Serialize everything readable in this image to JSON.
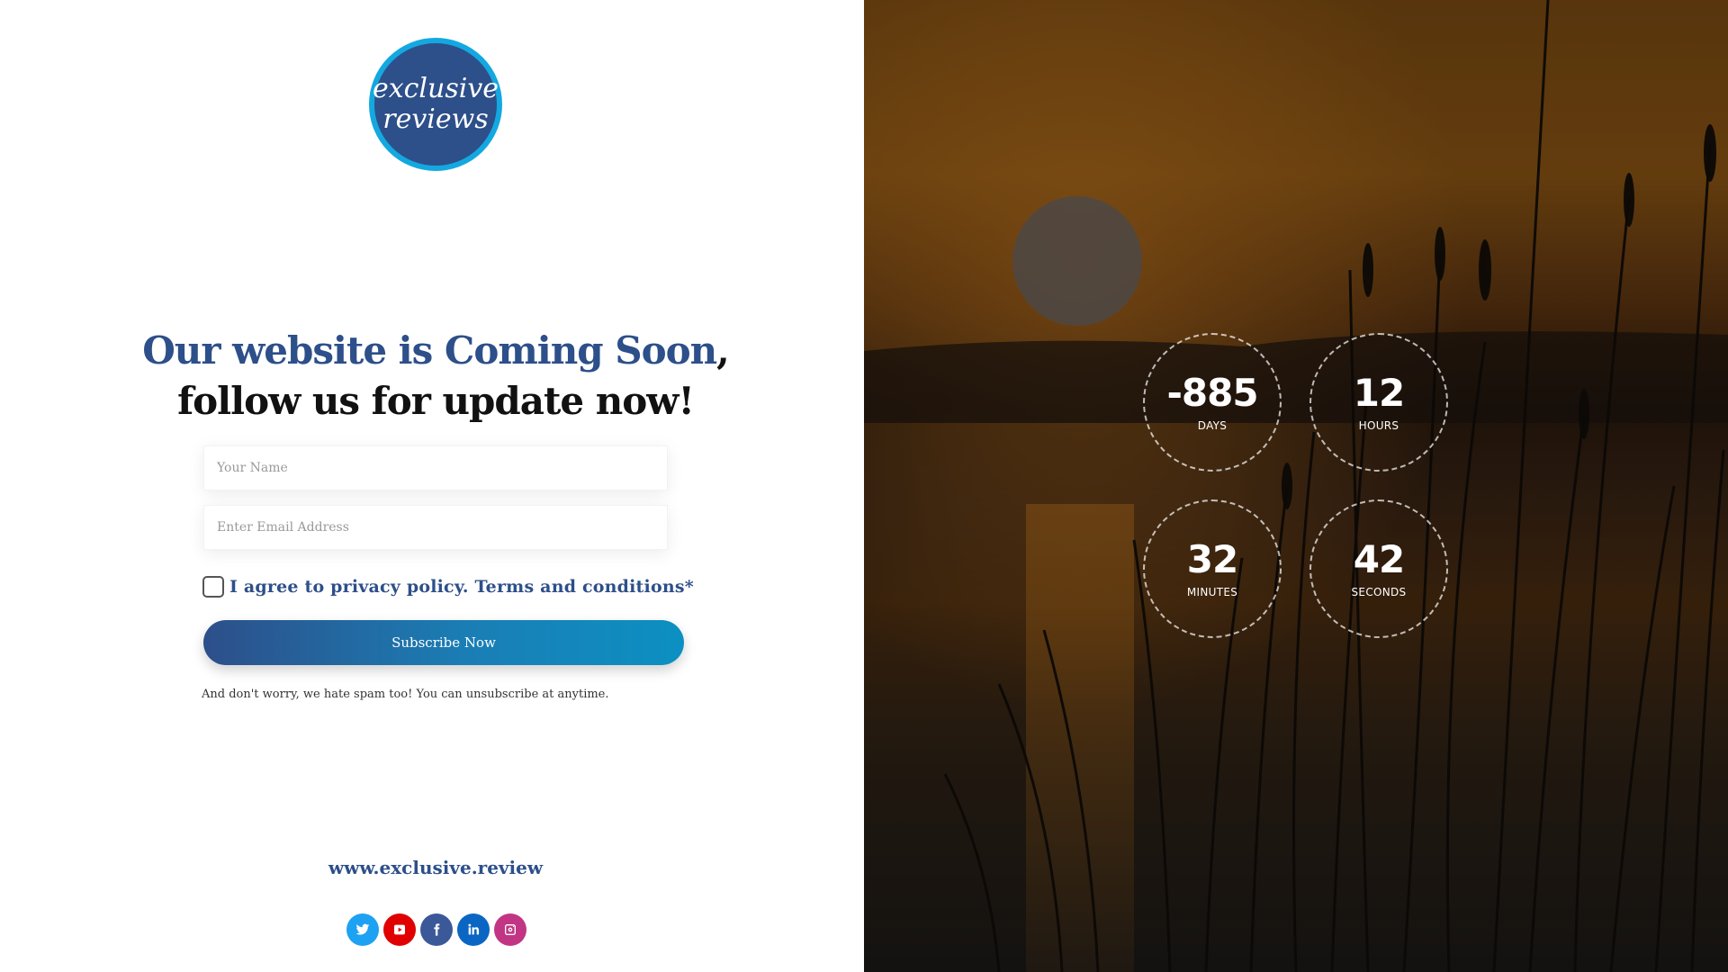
{
  "logo": {
    "line1": "exclusive",
    "line2": "reviews"
  },
  "headline": {
    "highlight": "Our website is Coming Soon",
    "comma": ",",
    "line2": "follow us for update now!"
  },
  "form": {
    "name_placeholder": "Your Name",
    "email_placeholder": "Enter Email Address",
    "agree_label": "I agree to privacy policy. Terms and conditions*",
    "subscribe_label": "Subscribe Now",
    "spam_note": "And don't worry, we hate spam too! You can unsubscribe at anytime."
  },
  "footer": {
    "site_url": "www.exclusive.review",
    "social": [
      {
        "icon": "twitter-icon",
        "color": "#1da1f2"
      },
      {
        "icon": "youtube-icon",
        "color": "#e00000"
      },
      {
        "icon": "facebook-icon",
        "color": "#3b5998"
      },
      {
        "icon": "linkedin-icon",
        "color": "#0a66c2"
      },
      {
        "icon": "instagram-icon",
        "color": "#c13584"
      }
    ]
  },
  "countdown": {
    "days": {
      "value": "-885",
      "label": "DAYS"
    },
    "hours": {
      "value": "12",
      "label": "HOURS"
    },
    "minutes": {
      "value": "32",
      "label": "MINUTES"
    },
    "seconds": {
      "value": "42",
      "label": "SECONDS"
    }
  },
  "colors": {
    "brand": "#2d4f8a",
    "accent": "#14a8e0"
  }
}
